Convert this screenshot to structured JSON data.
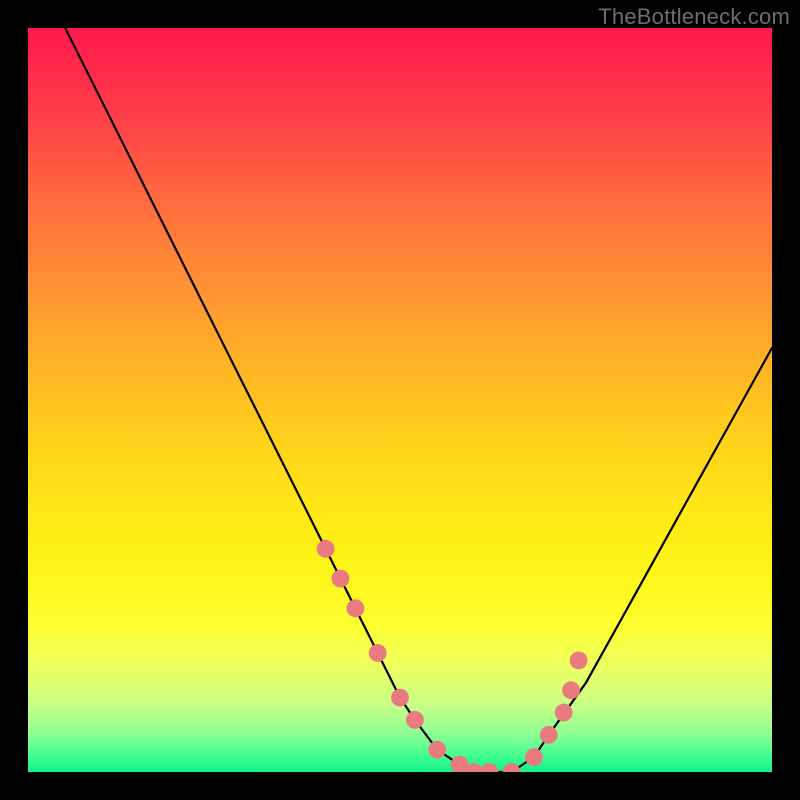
{
  "watermark": "TheBottleneck.com",
  "chart_data": {
    "type": "line",
    "title": "",
    "xlabel": "",
    "ylabel": "",
    "xlim": [
      0,
      100
    ],
    "ylim": [
      0,
      100
    ],
    "grid": false,
    "legend": false,
    "series": [
      {
        "name": "curve",
        "x": [
          5,
          10,
          15,
          20,
          25,
          30,
          35,
          40,
          45,
          50,
          52,
          55,
          58,
          60,
          62,
          65,
          68,
          70,
          75,
          80,
          85,
          90,
          95,
          100
        ],
        "y": [
          100,
          90,
          80,
          70,
          60,
          50,
          40,
          30,
          20,
          10,
          7,
          3,
          1,
          0,
          0,
          0,
          2,
          5,
          12,
          21,
          30,
          39,
          48,
          57
        ]
      }
    ],
    "markers": {
      "name": "highlight-points",
      "color": "#e97a80",
      "radius_pct": 1.2,
      "x": [
        40,
        42,
        44,
        47,
        50,
        52,
        55,
        58,
        60,
        62,
        65,
        68,
        70,
        72,
        73,
        74
      ],
      "y": [
        30,
        26,
        22,
        16,
        10,
        7,
        3,
        1,
        0,
        0,
        0,
        2,
        5,
        8,
        11,
        15
      ]
    },
    "background_gradient": {
      "stops": [
        {
          "pct": 0,
          "color": "#ff1a4d"
        },
        {
          "pct": 24,
          "color": "#ff6e3e"
        },
        {
          "pct": 55,
          "color": "#ffd01c"
        },
        {
          "pct": 80,
          "color": "#fdff2e"
        },
        {
          "pct": 95,
          "color": "#8bff94"
        },
        {
          "pct": 100,
          "color": "#14f08a"
        }
      ]
    }
  }
}
